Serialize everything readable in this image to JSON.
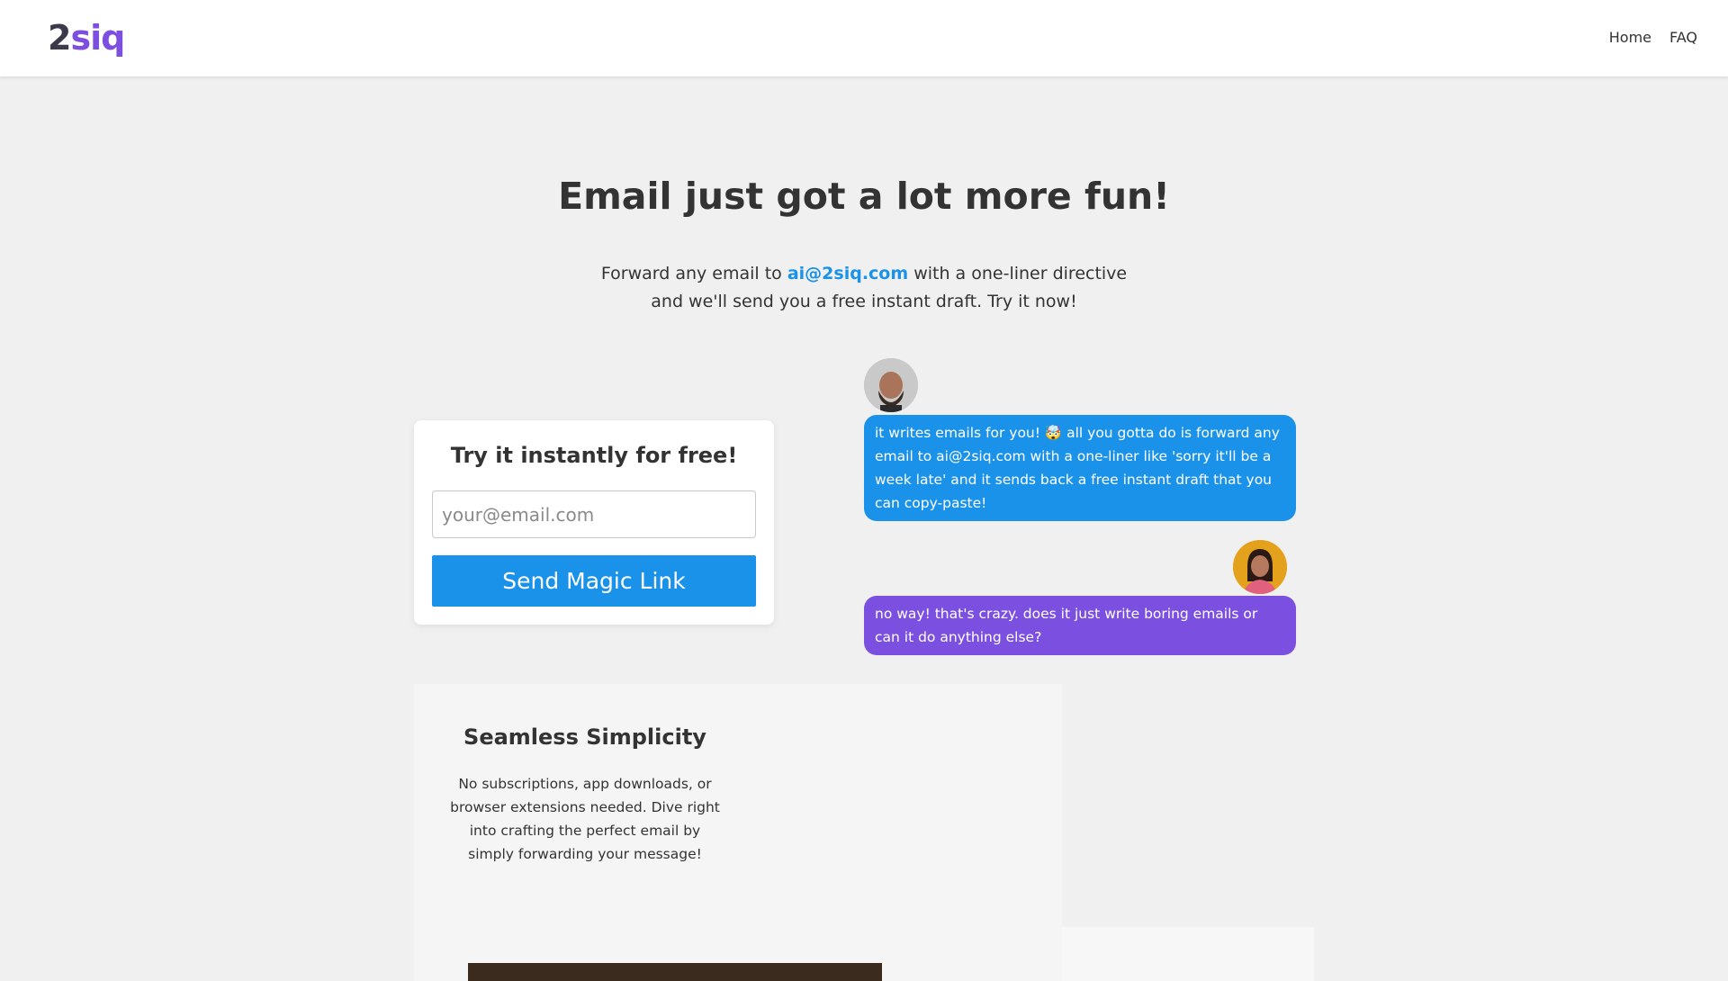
{
  "nav": {
    "logo_num": "2",
    "logo_word": "siq",
    "links": [
      "Home",
      "FAQ"
    ]
  },
  "hero": {
    "title": "Email just got a lot more fun!",
    "sub_before": "Forward any email to ",
    "sub_email": "ai@2siq.com",
    "sub_after": " with a one-liner directive and we'll send you a free instant draft. Try it now!"
  },
  "signup": {
    "title": "Try it instantly for free!",
    "email_placeholder": "your@email.com",
    "button_label": "Send Magic Link"
  },
  "chat": {
    "messages": [
      "it writes emails for you! 🤯 all you gotta do is forward any email to ai@2siq.com with a one-liner like 'sorry it'll be a week late' and it sends back a free instant draft that you can copy-paste!",
      "no way! that's crazy. does it just write boring emails or can it do anything else?"
    ]
  },
  "feature": {
    "title": "Seamless Simplicity",
    "text": "No subscriptions, app downloads, or browser extensions needed. Dive right into crafting the perfect email by simply forwarding your message!"
  },
  "colors": {
    "accent_blue": "#1a92ea",
    "accent_purple": "#7b4fdf",
    "logo_purple": "#7c4fe0",
    "background": "#f0f0f0"
  }
}
